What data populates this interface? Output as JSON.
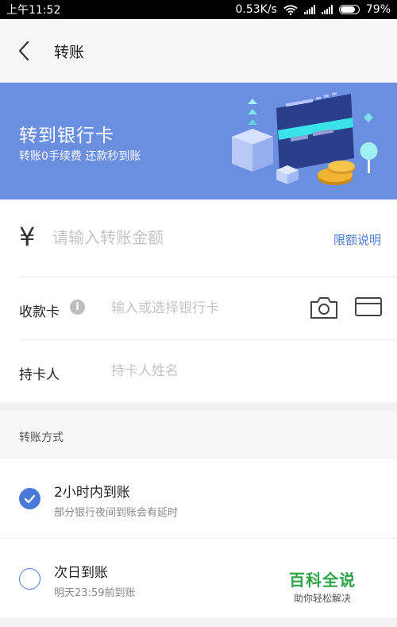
{
  "status_bar": {
    "time": "上午11:52",
    "network_speed": "0.53K/s",
    "battery": "79%",
    "icons": [
      "wifi-icon",
      "signal-icon",
      "signal-icon",
      "battery-icon"
    ]
  },
  "header": {
    "back_icon": "chevron-left-icon",
    "title": "转账"
  },
  "banner": {
    "title": "转到银行卡",
    "subtitle": "转账0手续费 还款秒到账",
    "background": "#6b8fe0"
  },
  "form": {
    "currency_symbol": "¥",
    "amount_placeholder": "请输入转账金额",
    "limit_link": "限额说明",
    "card_label": "收款卡",
    "card_info_icon": "info-icon",
    "card_placeholder": "输入或选择银行卡",
    "card_icons": [
      "camera-icon",
      "bank-card-icon"
    ],
    "holder_label": "持卡人",
    "holder_placeholder": "持卡人姓名"
  },
  "transfer_method": {
    "section_title": "转账方式",
    "options": [
      {
        "title": "2小时内到账",
        "subtitle": "部分银行夜间到账会有延时",
        "selected": true
      },
      {
        "title": "次日到账",
        "subtitle": "明天23:59前到账",
        "selected": false
      }
    ]
  },
  "watermark": {
    "title": "百科全说",
    "subtitle": "助你轻松解决"
  },
  "colors": {
    "accent": "#4a7ad9",
    "placeholder": "#c4c4c4",
    "watermark_green": "#2ea347"
  }
}
